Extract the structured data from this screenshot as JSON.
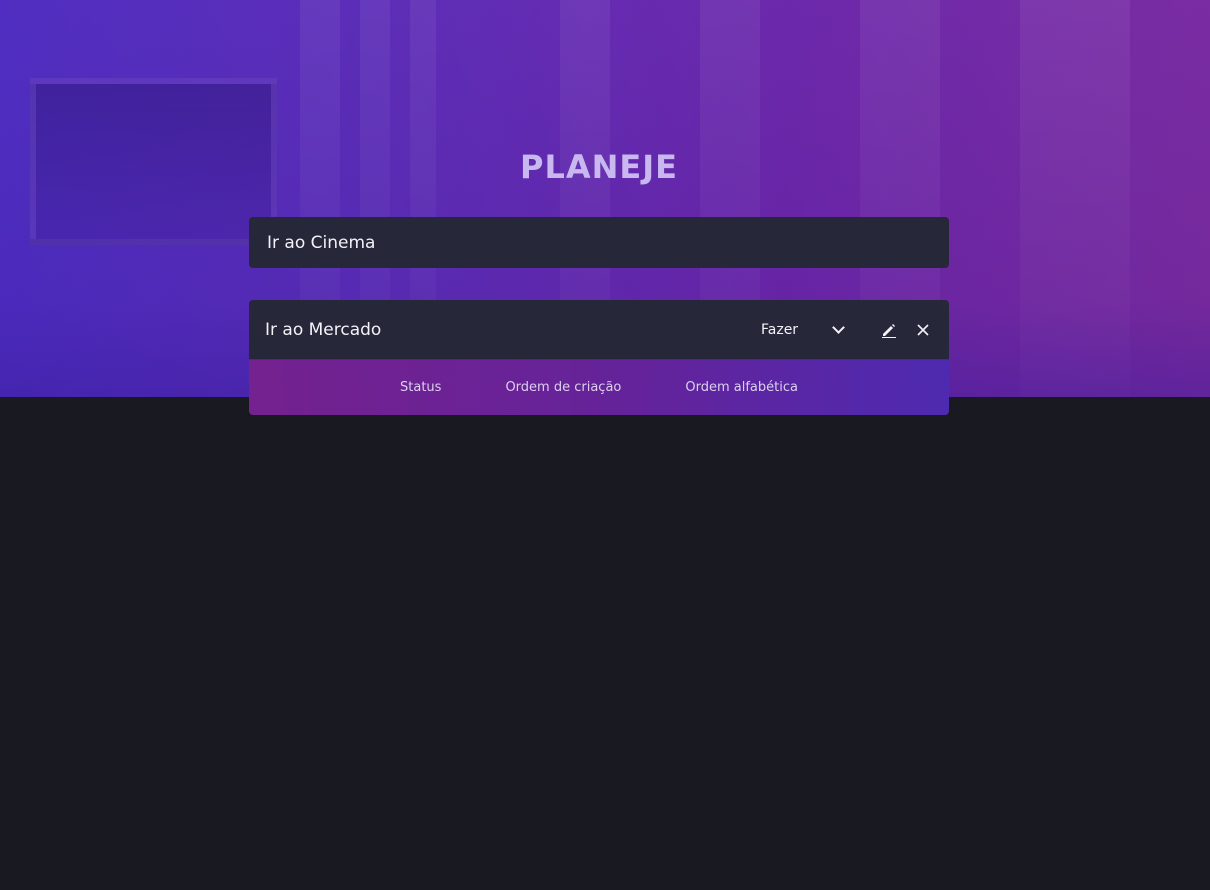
{
  "app": {
    "title": "PLANEJE"
  },
  "new_task": {
    "value": "Ir ao Cinema"
  },
  "tasks": [
    {
      "name": "Ir ao Mercado",
      "status": "Fazer"
    }
  ],
  "sort": {
    "status_label": "Status",
    "created_label": "Ordem de criação",
    "alpha_label": "Ordem alfabética"
  },
  "icons": {
    "edit": "pencil-icon",
    "delete": "close-icon",
    "dropdown": "chevron-down-icon"
  },
  "colors": {
    "background": "#191922",
    "card": "#262739",
    "title": "#c9b8f0",
    "accent_start": "#74228f",
    "accent_end": "#4e2ab0"
  }
}
